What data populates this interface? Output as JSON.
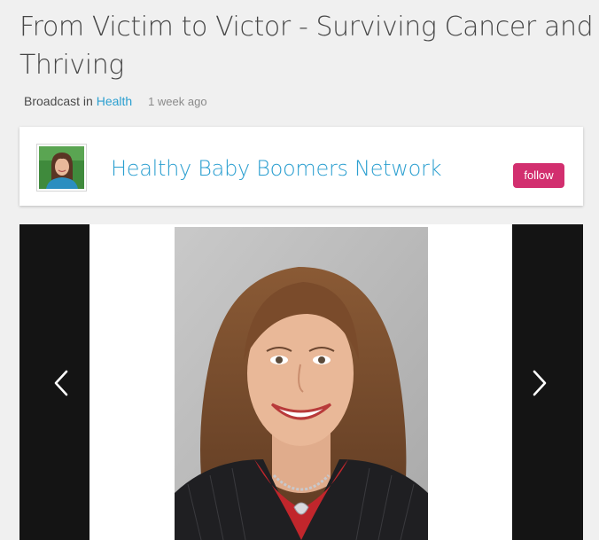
{
  "post": {
    "title": "From Victim to Victor - Surviving Cancer and Thriving",
    "broadcast_prefix": "Broadcast in",
    "category": "Health",
    "time_ago": "1 week ago"
  },
  "channel": {
    "name": "Healthy Baby Boomers Network",
    "follow_label": "follow"
  },
  "gallery": {
    "prev_icon": "chevron-left-icon",
    "next_icon": "chevron-right-icon"
  },
  "colors": {
    "link": "#2b9fd0",
    "follow_button": "#d22f6f",
    "page_background": "#f0f0f0",
    "viewer_side_panels": "#141414"
  }
}
